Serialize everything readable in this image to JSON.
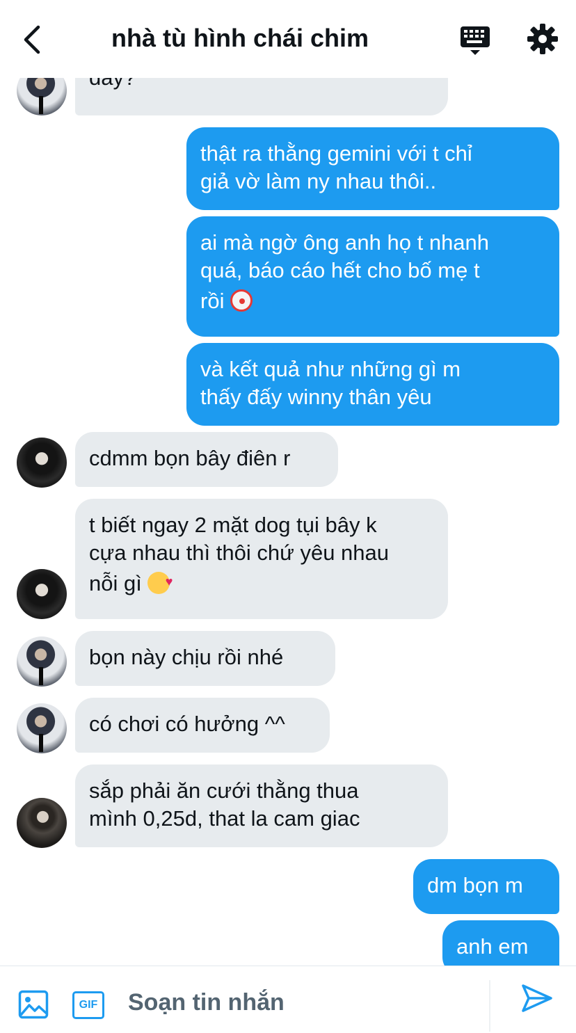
{
  "header": {
    "title": "nhà tù hình chái chim",
    "back_icon": "chevron-left-icon",
    "keyboard_icon": "keyboard-icon",
    "settings_icon": "gear-icon"
  },
  "messages": [
    {
      "direction": "in",
      "avatar": "avatar-c",
      "lines": [
        "đấy?"
      ]
    },
    {
      "direction": "out",
      "lines": [
        "thật ra thằng gemini với t chỉ",
        "giả vờ làm ny nhau thôi.."
      ]
    },
    {
      "direction": "out",
      "lines": [
        "ai mà ngờ ông anh họ t nhanh",
        "quá, báo cáo hết cho bố mẹ t",
        "rồi"
      ],
      "emoji": "clown-face"
    },
    {
      "direction": "out",
      "lines": [
        "và kết quả như những gì m",
        "thấy đấy winny thân yêu"
      ]
    },
    {
      "direction": "in",
      "avatar": "avatar-b",
      "lines": [
        "cdmm bọn bây điên r"
      ]
    },
    {
      "direction": "in",
      "avatar": "avatar-b",
      "lines": [
        "t biết ngay 2 mặt dog tụi bây k",
        "cựa nhau thì thôi chứ yêu nhau",
        "nỗi gì"
      ],
      "emoji": "smiling-face-with-hearts"
    },
    {
      "direction": "in",
      "avatar": "avatar-c",
      "lines": [
        "bọn này chịu rồi nhé"
      ]
    },
    {
      "direction": "in",
      "avatar": "avatar-c",
      "lines": [
        "có chơi có hưởng ^^"
      ]
    },
    {
      "direction": "in",
      "avatar": "avatar-a",
      "lines": [
        "sắp phải ăn cưới thằng thua",
        "mình 0,25d, that la cam giac"
      ]
    },
    {
      "direction": "out",
      "lines": [
        "dm bọn m"
      ]
    },
    {
      "direction": "out",
      "lines": [
        "anh em"
      ]
    }
  ],
  "composer": {
    "placeholder": "Soạn tin nhắn",
    "image_icon": "image-icon",
    "gif_label": "GIF",
    "send_icon": "send-icon"
  },
  "colors": {
    "accent": "#1d9bf0",
    "incoming_bubble": "#e7ebee",
    "text": "#0f1419",
    "muted": "#536471"
  }
}
